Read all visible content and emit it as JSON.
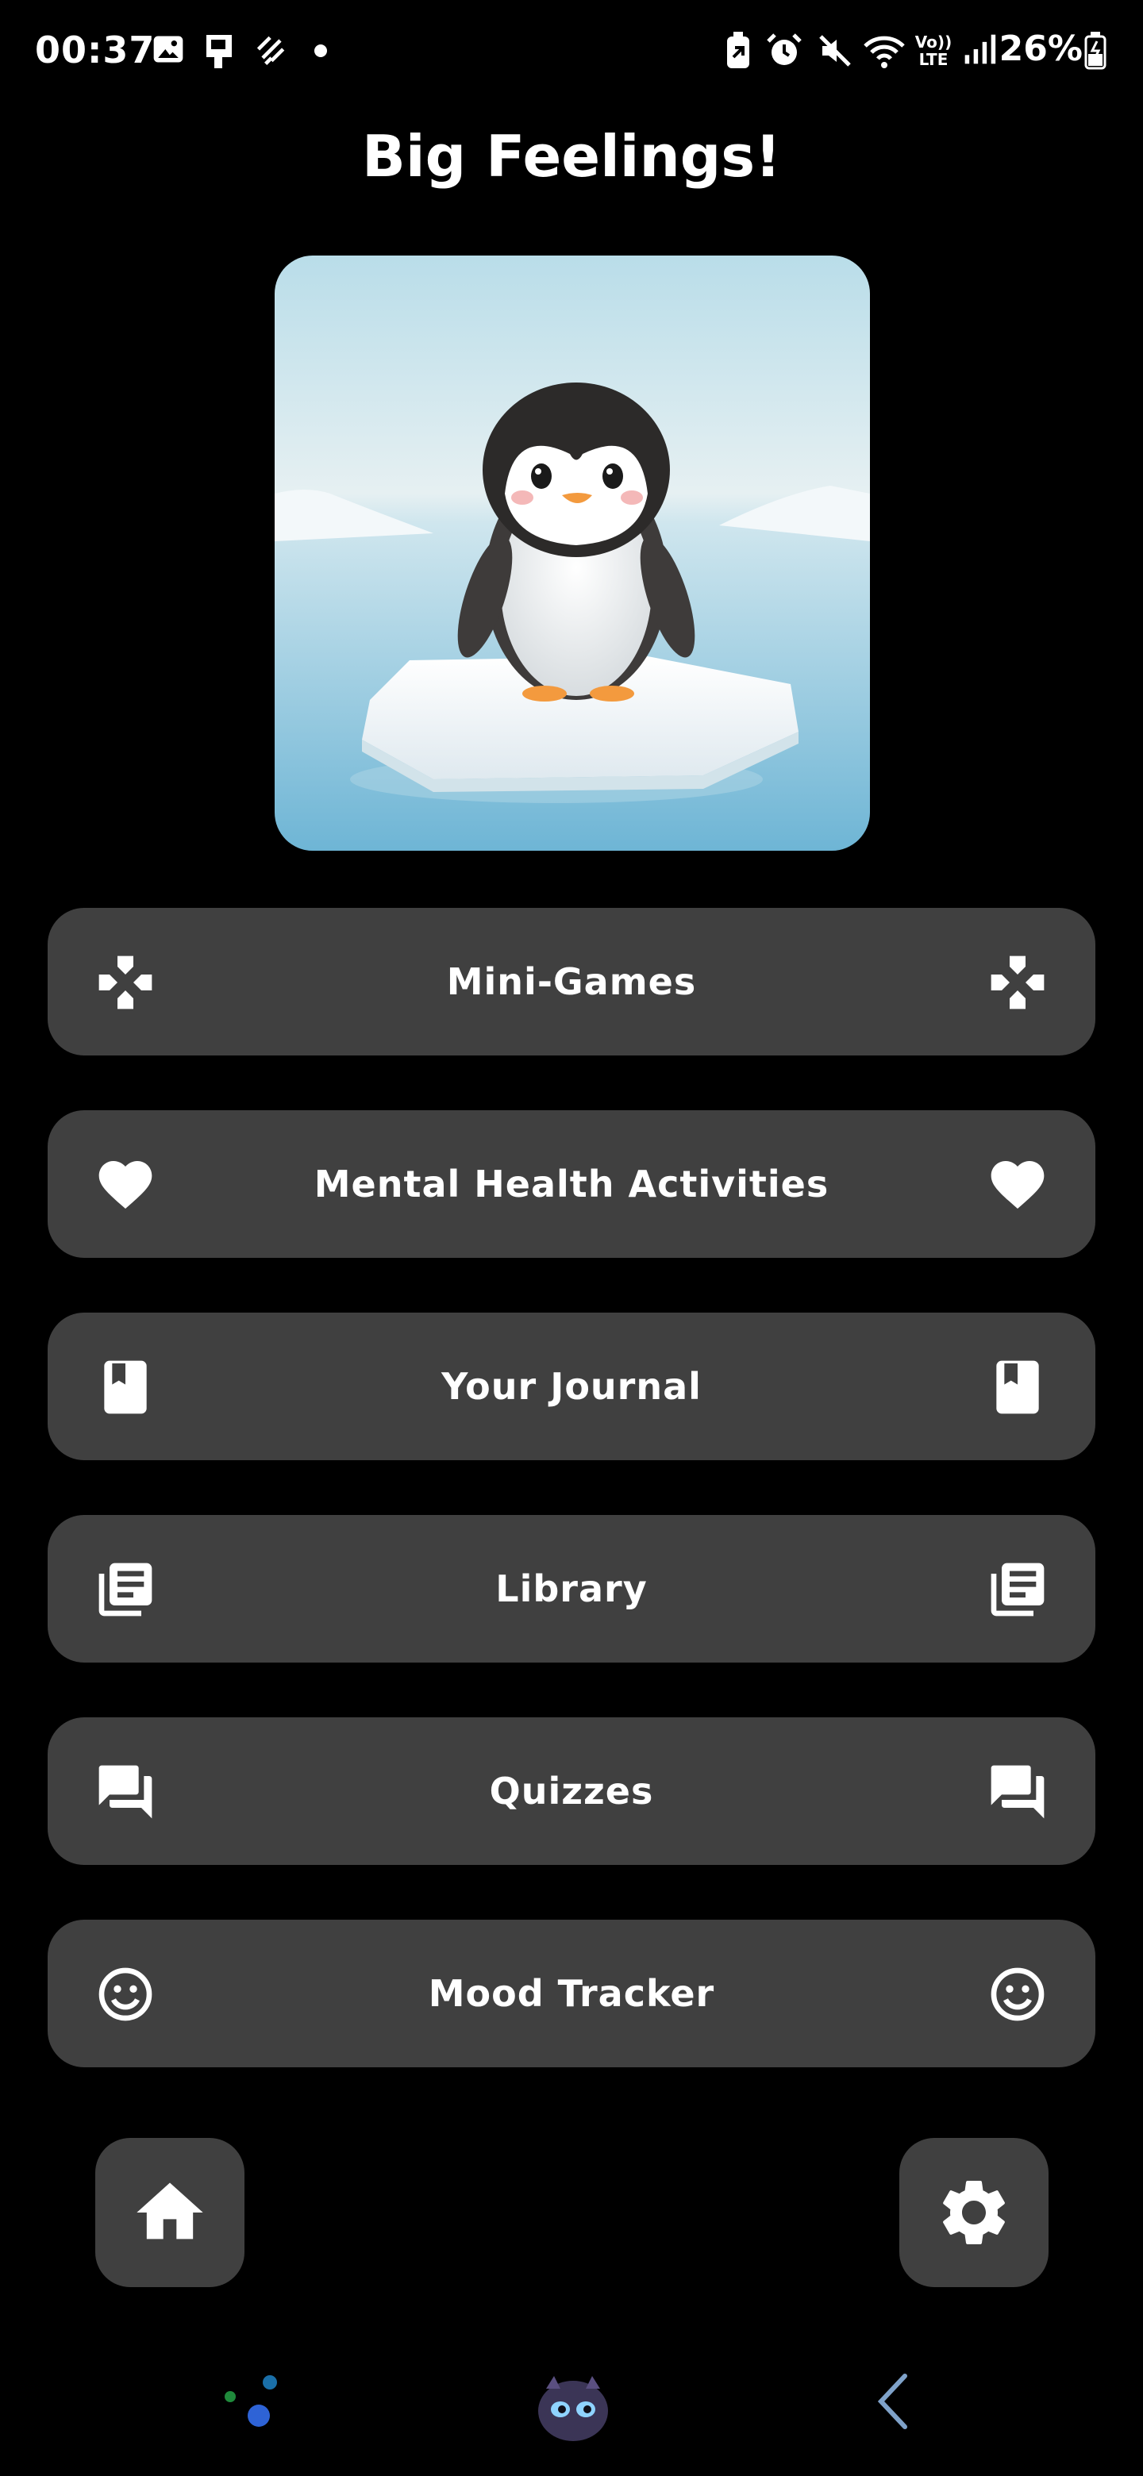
{
  "status_bar": {
    "time": "00:37",
    "battery": "26%",
    "icons": [
      "image-icon",
      "sim-icon",
      "data-saver-icon",
      "dot-icon",
      "battery-saver-icon",
      "alarm-icon",
      "mute-icon",
      "wifi-icon",
      "volte-icon",
      "signal-icon",
      "battery-icon"
    ],
    "volte_text": "Vo)) LTE"
  },
  "app": {
    "title": "Big Feelings!"
  },
  "hero_image": {
    "alt": "penguin-on-ice-floe"
  },
  "menu": [
    {
      "label": "Mini-Games",
      "icon": "gamepad-icon"
    },
    {
      "label": "Mental Health Activities",
      "icon": "heart-icon"
    },
    {
      "label": "Your Journal",
      "icon": "book-icon"
    },
    {
      "label": "Library",
      "icon": "library-icon"
    },
    {
      "label": "Quizzes",
      "icon": "chat-bubbles-icon"
    },
    {
      "label": "Mood Tracker",
      "icon": "smiley-icon"
    }
  ],
  "bottom_buttons": {
    "home": "home-icon",
    "settings": "gear-icon"
  },
  "colors": {
    "background": "#000000",
    "button": "#404040",
    "text": "#ffffff"
  }
}
